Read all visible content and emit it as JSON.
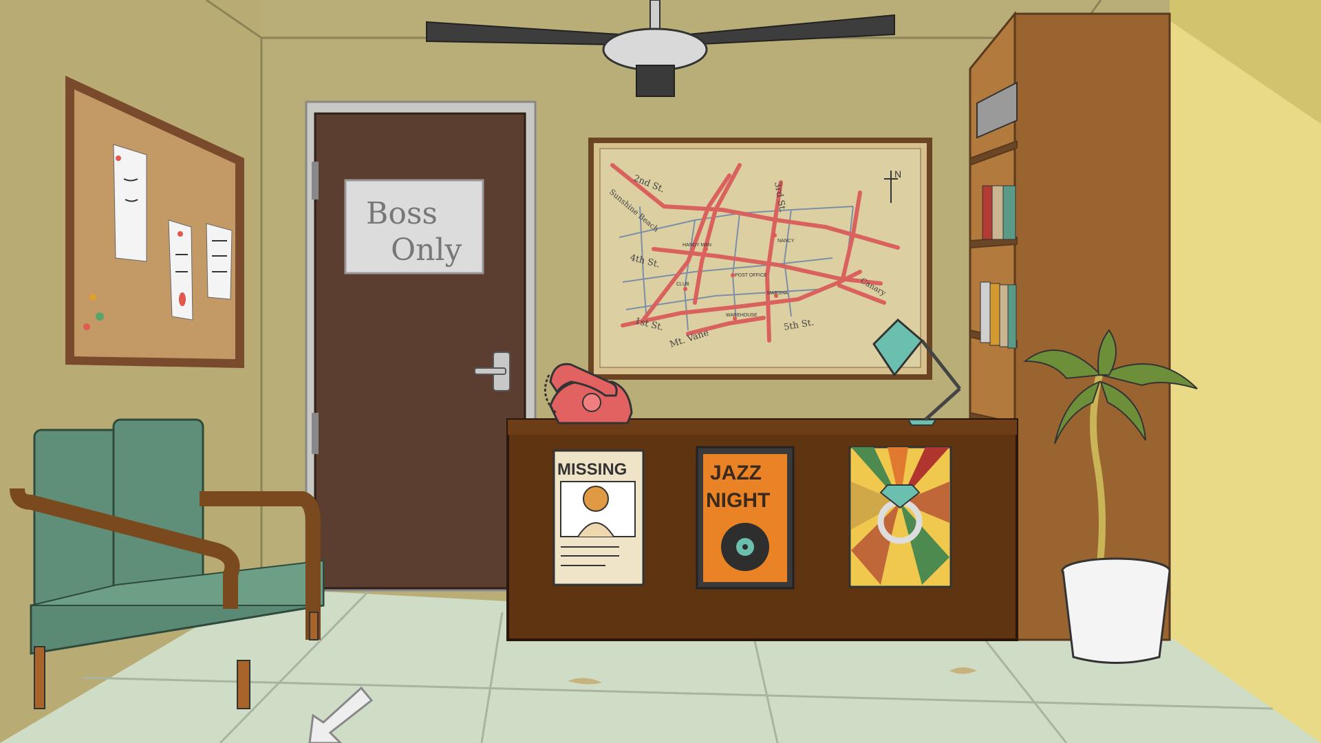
{
  "scene": {
    "door_sign_line1": "Boss",
    "door_sign_line2": "Only",
    "map": {
      "compass": "N",
      "streets": {
        "s2": "2nd St.",
        "s3": "3rd St.",
        "s4": "4th St.",
        "s1": "1st St.",
        "s5": "5th St.",
        "mt": "Mt. Vane",
        "sunshine": "Sunshine Beach",
        "canary": "Canary"
      },
      "places": {
        "handyman": "HANDY MAN",
        "nancy": "NANCY",
        "club": "CLUB",
        "post": "POST OFFICE",
        "marsha": "MARSHA",
        "warehouse": "WAREHOUSE"
      }
    },
    "posters": {
      "missing": "MISSING",
      "jazz1": "JAZZ",
      "jazz2": "NIGHT"
    }
  },
  "colors": {
    "wall": "#b9ad78",
    "floor": "#cfdcc6",
    "door": "#5b3e30",
    "desk": "#5f3411",
    "shelf": "#9a6431",
    "sofa": "#5f8f78",
    "street_red": "#d9625f"
  }
}
